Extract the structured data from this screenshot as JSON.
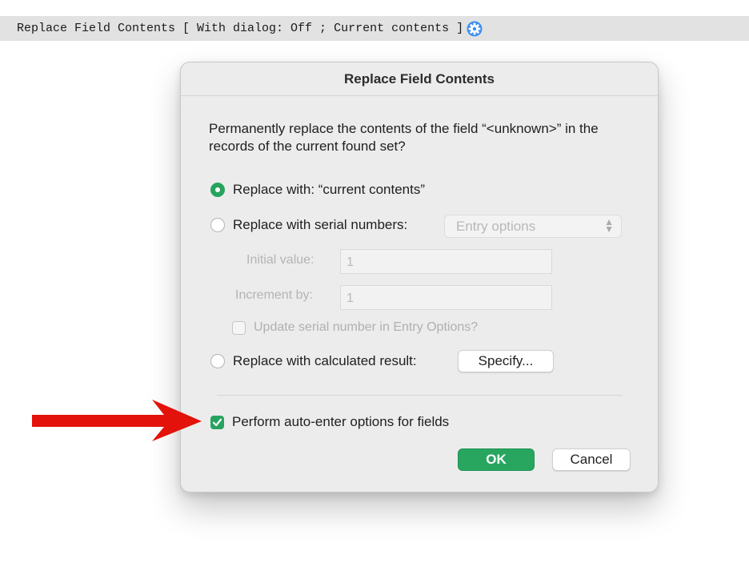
{
  "script_step": {
    "text": "Replace Field Contents [ With dialog: Off ; Current contents ]",
    "icon": "gear-icon"
  },
  "dialog": {
    "title": "Replace Field Contents",
    "message": "Permanently replace the contents of the field “<unknown>” in the records of the current found set?",
    "option_current": {
      "label": "Replace with: “current contents”",
      "selected": true
    },
    "option_serial": {
      "label": "Replace with serial numbers:",
      "selected": false
    },
    "serial_popup": {
      "value": "Entry options"
    },
    "initial_value": {
      "label": "Initial value:",
      "value": "1"
    },
    "increment_by": {
      "label": "Increment by:",
      "value": "1"
    },
    "update_serial": {
      "label": "Update serial number in Entry Options?",
      "checked": false
    },
    "option_calc": {
      "label": "Replace with calculated result:",
      "selected": false
    },
    "specify_button": "Specify...",
    "auto_enter": {
      "label": "Perform auto-enter options for fields",
      "checked": true
    },
    "ok_button": "OK",
    "cancel_button": "Cancel"
  },
  "colors": {
    "accent": "#27a35e",
    "annotation_arrow": "#e3120b",
    "scriptline_bg": "#e2e2e2",
    "gear_icon": "#3d8ff0"
  }
}
